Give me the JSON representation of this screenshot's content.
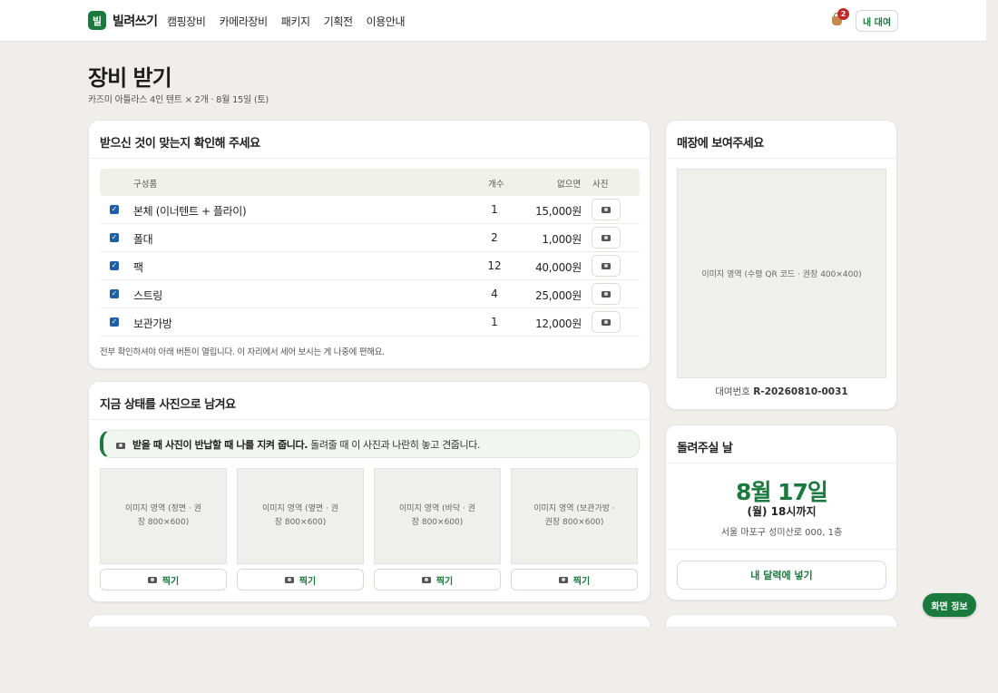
{
  "header": {
    "logo_char": "빌",
    "brand": "빌려쓰기",
    "nav": [
      "캠핑장비",
      "카메라장비",
      "패키지",
      "기획전",
      "이용안내"
    ],
    "cart_count": "2",
    "my_rental": "내 대여"
  },
  "page": {
    "title": "장비 받기",
    "subtitle": "카즈미 아틀라스 4인 텐트 × 2개 · 8월 15일 (토)"
  },
  "checklist": {
    "title": "받으신 것이 맞는지 확인해 주세요",
    "columns": {
      "item": "구성품",
      "qty": "개수",
      "lost": "없으면",
      "photo": "사진"
    },
    "rows": [
      {
        "name": "본체 (이너텐트 + 플라이)",
        "qty": "1",
        "price": "15,000원",
        "checked": true
      },
      {
        "name": "폴대",
        "qty": "2",
        "price": "1,000원",
        "checked": true
      },
      {
        "name": "팩",
        "qty": "12",
        "price": "40,000원",
        "checked": true
      },
      {
        "name": "스트링",
        "qty": "4",
        "price": "25,000원",
        "checked": true
      },
      {
        "name": "보관가방",
        "qty": "1",
        "price": "12,000원",
        "checked": true
      }
    ],
    "note": "전부 확인하셔야 아래 버튼이 열립니다. 이 자리에서 세어 보시는 게 나중에 편해요."
  },
  "photos": {
    "title": "지금 상태를 사진으로 남겨요",
    "notice_bold": "받을 때 사진이 반납할 때 나를 지켜 줍니다.",
    "notice_rest": " 돌려줄 때 이 사진과 나란히 놓고 견줍니다.",
    "slots": [
      {
        "placeholder": "이미지 영역 (정면 · 권장 800×600)",
        "button": "찍기"
      },
      {
        "placeholder": "이미지 영역 (옆면 · 권장 800×600)",
        "button": "찍기"
      },
      {
        "placeholder": "이미지 영역 (바닥 · 권장 800×600)",
        "button": "찍기"
      },
      {
        "placeholder": "이미지 영역 (보관가방 · 권장 800×600)",
        "button": "찍기"
      }
    ]
  },
  "qr": {
    "title": "매장에 보여주세요",
    "placeholder": "이미지 영역 (수령 QR 코드 · 권장 400×400)",
    "id_label": "대여번호 ",
    "id_value": "R-20260810-0031"
  },
  "return": {
    "title": "돌려주실 날",
    "date": "8월 17일",
    "time": "(월) 18시까지",
    "address": "서울 마포구 성미산로 000, 1층",
    "calendar_button": "내 달력에 넣기"
  },
  "screen_info": "화면 정보"
}
